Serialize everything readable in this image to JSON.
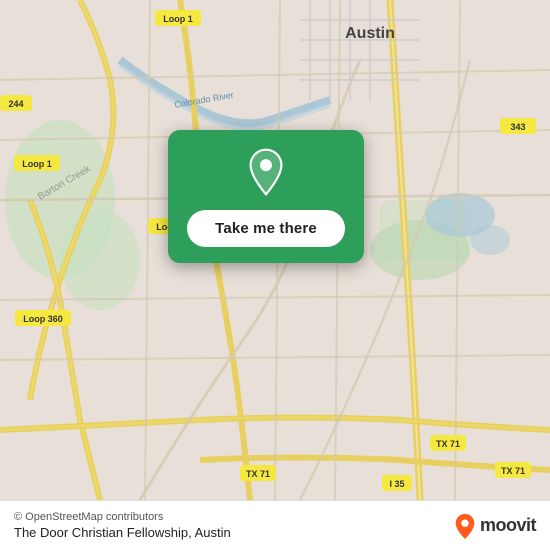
{
  "map": {
    "attribution": "© OpenStreetMap contributors",
    "backgroundColor": "#e8e0d8"
  },
  "card": {
    "button_label": "Take me there",
    "pin_color": "#ffffff",
    "background_color": "#2e9e5b"
  },
  "bottom_bar": {
    "attribution": "© OpenStreetMap contributors",
    "location_name": "The Door Christian Fellowship, Austin",
    "moovit_text": "moovit"
  },
  "moovit": {
    "pin_color": "#ff5a1f"
  }
}
